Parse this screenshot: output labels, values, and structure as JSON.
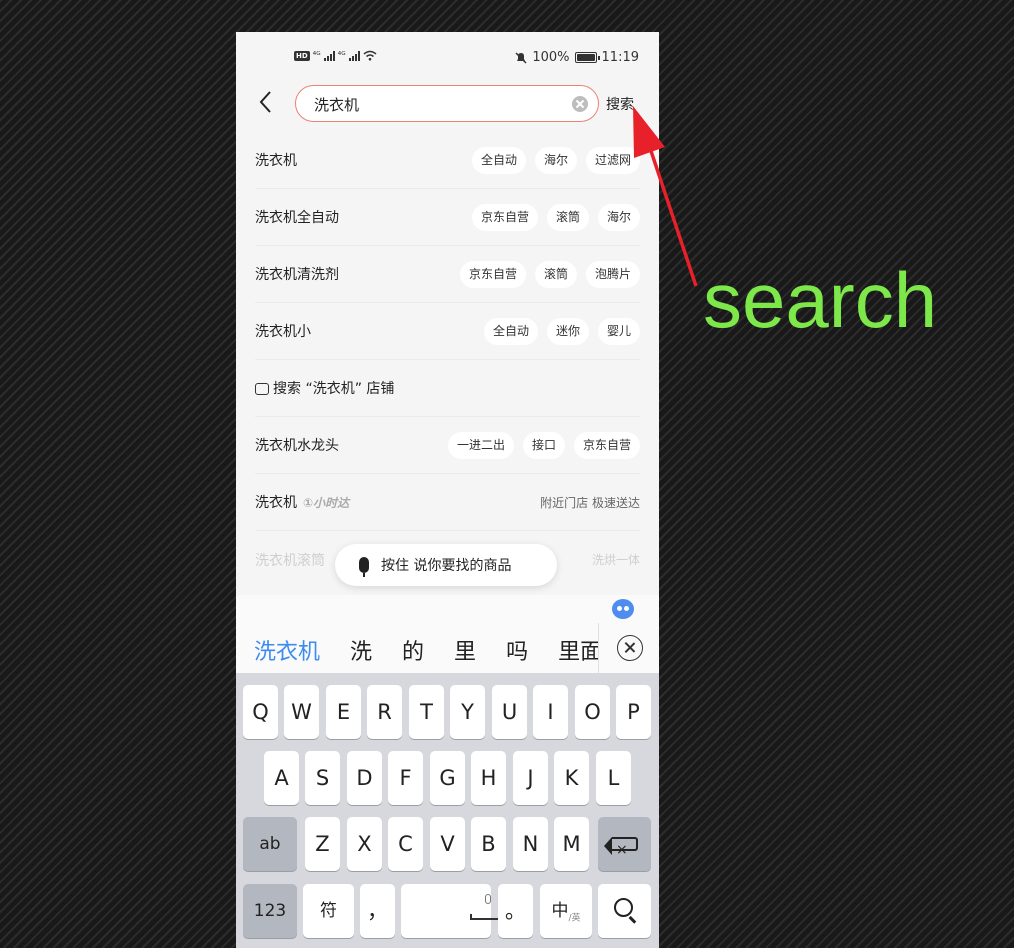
{
  "status_bar": {
    "network_left": "HD 4G 4G",
    "battery": "100%",
    "time": "11:19"
  },
  "search": {
    "query": "洗衣机",
    "submit_label": "搜索"
  },
  "suggestions": [
    {
      "term": "洗衣机",
      "tags": [
        "全自动",
        "海尔",
        "过滤网"
      ]
    },
    {
      "term": "洗衣机全自动",
      "tags": [
        "京东自营",
        "滚筒",
        "海尔"
      ]
    },
    {
      "term": "洗衣机清洗剂",
      "tags": [
        "京东自营",
        "滚筒",
        "泡腾片"
      ]
    },
    {
      "term": "洗衣机小",
      "tags": [
        "全自动",
        "迷你",
        "婴儿"
      ]
    },
    {
      "term": "搜索 “洗衣机” 店铺",
      "type": "store"
    },
    {
      "term": "洗衣机水龙头",
      "tags": [
        "一进二出",
        "接口",
        "京东自营"
      ]
    },
    {
      "term": "洗衣机",
      "badge": "①小时达",
      "right_text": "附近门店 极速送达"
    },
    {
      "term": "洗衣机滚筒",
      "right_text": "洗烘一体"
    }
  ],
  "voice_search": {
    "label": "按住 说你要找的商品"
  },
  "ime": {
    "candidates": [
      "洗衣机",
      "洗",
      "的",
      "里",
      "吗",
      "里面"
    ]
  },
  "keyboard": {
    "row1": [
      "Q",
      "W",
      "E",
      "R",
      "T",
      "Y",
      "U",
      "I",
      "O",
      "P"
    ],
    "row2": [
      "A",
      "S",
      "D",
      "F",
      "G",
      "H",
      "J",
      "K",
      "L"
    ],
    "row3_left": "ab",
    "row3": [
      "Z",
      "X",
      "C",
      "V",
      "B",
      "N",
      "M"
    ],
    "num_key": "123",
    "symbol_key": "符",
    "comma_key": "，",
    "period_key": "。",
    "lang_key": "中",
    "lang_sub": "/英"
  },
  "annotation": {
    "text": "search",
    "color": "#7ee84b",
    "arrow_color": "#e8202a"
  }
}
